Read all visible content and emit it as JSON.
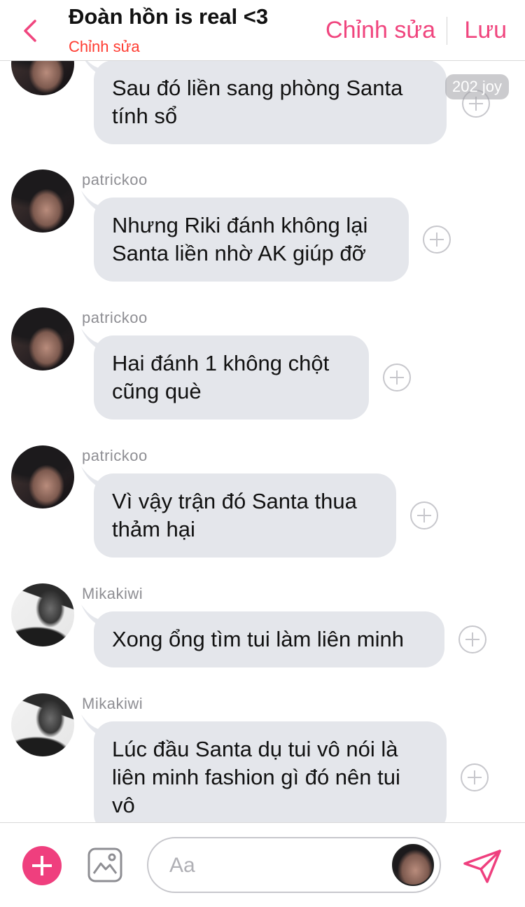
{
  "header": {
    "title": "Đoàn hồn is real <3",
    "subtitle": "Chỉnh sửa",
    "edit_label": "Chỉnh sửa",
    "save_label": "Lưu",
    "back_icon": "chevron-left-icon",
    "accent_color": "#f0457e"
  },
  "reaction_badge": "202 joy",
  "messages": [
    {
      "sender": "",
      "text": "Sau đó liền sang phòng Santa tính sổ",
      "avatar": "patrickoo"
    },
    {
      "sender": "patrickoo",
      "text": "Nhưng Riki đánh không lại Santa liền nhờ AK giúp đỡ",
      "avatar": "patrickoo"
    },
    {
      "sender": "patrickoo",
      "text": "Hai đánh 1 không chột cũng què",
      "avatar": "patrickoo"
    },
    {
      "sender": "patrickoo",
      "text": "Vì vậy trận đó Santa thua thảm hại",
      "avatar": "patrickoo"
    },
    {
      "sender": "Mikakiwi",
      "text": "Xong ổng tìm tui làm liên minh",
      "avatar": "Mikakiwi"
    },
    {
      "sender": "Mikakiwi",
      "text": "Lúc đầu Santa dụ tui vô nói là liên minh fashion gì đó nên tui vô",
      "avatar": "Mikakiwi"
    }
  ],
  "composer": {
    "placeholder": "Aa",
    "value": "",
    "add_icon": "plus-icon",
    "image_icon": "image-icon",
    "send_icon": "send-icon"
  },
  "colors": {
    "bubble": "#e4e6eb",
    "accent": "#ef3f7e",
    "subtitle": "#ff3b30"
  }
}
